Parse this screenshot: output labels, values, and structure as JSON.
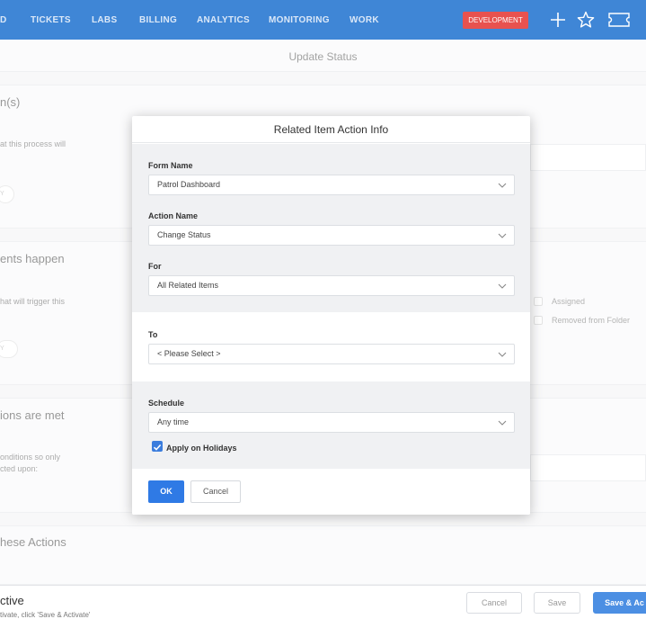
{
  "nav": {
    "items": [
      {
        "label": "D"
      },
      {
        "label": "TICKETS"
      },
      {
        "label": "LABS"
      },
      {
        "label": "BILLING"
      },
      {
        "label": "ANALYTICS"
      },
      {
        "label": "MONITORING"
      },
      {
        "label": "WORK"
      }
    ],
    "badge": "DEVELOPMENT",
    "icons": [
      "plus-icon",
      "star-icon",
      "ticket-icon"
    ]
  },
  "page": {
    "subheader_title": "Update Status",
    "sections": [
      {
        "heading": "n(s)",
        "text": "at this process will",
        "pill": "Y"
      },
      {
        "heading": "ents happen",
        "text": "hat will trigger this",
        "pill": "Y"
      },
      {
        "heading": "ions are met",
        "text": "onditions so only\ncted upon:"
      },
      {
        "heading": "hese Actions"
      }
    ],
    "checks": [
      {
        "label": "Assigned"
      },
      {
        "label": "Removed from Folder"
      }
    ]
  },
  "bottom": {
    "title": "ctive",
    "subtitle": "tivate, click 'Save & Activate'",
    "cancel_label": "Cancel",
    "save_label": "Save",
    "save_activate_label": "Save & Ac"
  },
  "modal": {
    "title": "Related Item Action Info",
    "form_name": {
      "label": "Form Name",
      "value": "Patrol Dashboard"
    },
    "action_name": {
      "label": "Action Name",
      "value": "Change Status"
    },
    "for": {
      "label": "For",
      "value": "All Related Items"
    },
    "to": {
      "label": "To",
      "value": "< Please Select >"
    },
    "schedule": {
      "label": "Schedule",
      "value": "Any time"
    },
    "holidays": {
      "label": "Apply on Holidays",
      "checked": true
    },
    "ok_label": "OK",
    "cancel_label": "Cancel"
  },
  "colors": {
    "nav": "#3f86d6",
    "badge": "#e8524f",
    "primary": "#2f7ae5"
  }
}
